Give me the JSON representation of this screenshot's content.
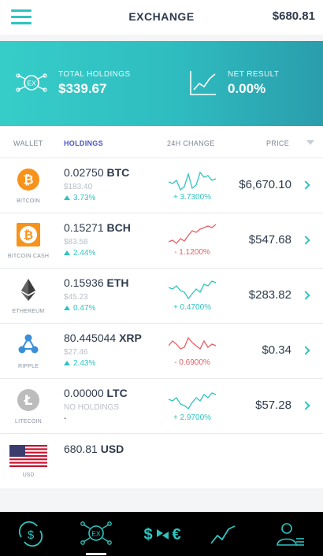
{
  "header": {
    "title": "EXCHANGE",
    "balance": "$680.81",
    "menu_icon": "hamburger-icon"
  },
  "summary": {
    "holdings_label": "TOTAL HOLDINGS",
    "holdings_value": "$339.67",
    "net_label": "NET RESULT",
    "net_value": "0.00%",
    "accent": "#2ec4c0"
  },
  "columns": {
    "wallet": "WALLET",
    "holdings": "HOLDINGS",
    "change": "24H CHANGE",
    "price": "PRICE"
  },
  "coins": [
    {
      "name": "BITCOIN",
      "amount": "0.02750",
      "symbol": "BTC",
      "fiat": "$183.40",
      "pct": "3.73%",
      "change": "+ 3.7300%",
      "trend": "up",
      "price": "$6,670.10",
      "color": "#f7931a",
      "icon": "bitcoin-icon",
      "spark": [
        20,
        22,
        18,
        30,
        26,
        10,
        28,
        24,
        8,
        14,
        12,
        18,
        16
      ]
    },
    {
      "name": "BITCOIN CASH",
      "amount": "0.15271",
      "symbol": "BCH",
      "fiat": "$83.58",
      "pct": "2.44%",
      "change": "- 1.1200%",
      "trend": "down",
      "price": "$547.68",
      "color": "#f7931a",
      "icon": "bitcoin-cash-icon",
      "spark": [
        26,
        24,
        28,
        22,
        25,
        18,
        12,
        14,
        10,
        8,
        6,
        8,
        4
      ]
    },
    {
      "name": "ETHEREUM",
      "amount": "0.15936",
      "symbol": "ETH",
      "fiat": "$45.23",
      "pct": "0.47%",
      "change": "+ 0.4700%",
      "trend": "up",
      "price": "$283.82",
      "color": "#5a5a5a",
      "icon": "ethereum-icon",
      "spark": [
        14,
        16,
        12,
        18,
        20,
        28,
        22,
        16,
        20,
        10,
        12,
        6,
        8
      ]
    },
    {
      "name": "RIPPLE",
      "amount": "80.445044",
      "symbol": "XRP",
      "fiat": "$27.46",
      "pct": "2.43%",
      "change": "- 0.6900%",
      "trend": "down",
      "price": "$0.34",
      "color": "#3a8fd8",
      "icon": "ripple-icon",
      "spark": [
        18,
        12,
        16,
        22,
        20,
        8,
        14,
        18,
        22,
        12,
        20,
        16,
        18
      ]
    },
    {
      "name": "LITECOIN",
      "amount": "0.00000",
      "symbol": "LTC",
      "fiat": "NO HOLDINGS",
      "pct": "-",
      "change": "+ 2.9700%",
      "trend": "up",
      "price": "$57.28",
      "color": "#bcbcbc",
      "icon": "litecoin-icon",
      "spark": [
        16,
        18,
        14,
        22,
        24,
        28,
        20,
        14,
        18,
        10,
        14,
        8,
        10
      ]
    }
  ],
  "usd": {
    "name": "USD",
    "amount": "680.81",
    "symbol": "USD",
    "icon": "us-flag-icon"
  },
  "tabs": [
    {
      "name": "wallet",
      "icon": "dollar-cycle-icon"
    },
    {
      "name": "exchange",
      "icon": "ex-icon"
    },
    {
      "name": "convert",
      "icon": "currency-swap-icon"
    },
    {
      "name": "charts",
      "icon": "trend-icon"
    },
    {
      "name": "profile",
      "icon": "profile-icon"
    }
  ],
  "colors": {
    "up": "#2ec4c0",
    "down": "#e85f63",
    "tab_bg": "#000000",
    "tab_icon": "#2ec4c0"
  }
}
